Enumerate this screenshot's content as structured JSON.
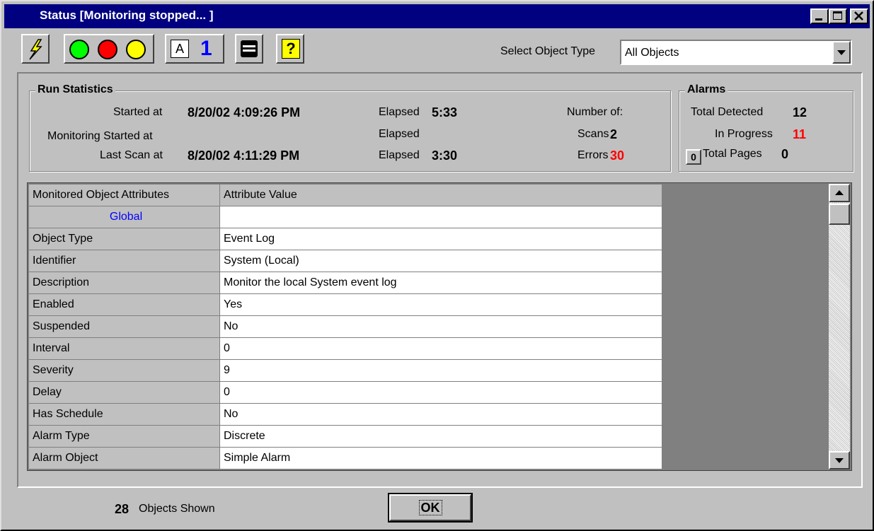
{
  "window": {
    "title": "Status [Monitoring stopped... ]"
  },
  "toolbar": {
    "select_label": "Select Object Type",
    "select_value": "All Objects",
    "number_button": "1"
  },
  "run_stats": {
    "group_label": "Run Statistics",
    "started_label": "Started at",
    "started_value": "8/20/02 4:09:26 PM",
    "monitoring_label": "Monitoring Started at",
    "lastscan_label": "Last Scan at",
    "lastscan_value": "8/20/02 4:11:29 PM",
    "elapsed_label": "Elapsed",
    "elapsed1": "5:33",
    "elapsed3": "3:30",
    "number_of": "Number of:",
    "scans_label": "Scans",
    "scans_value": "2",
    "errors_label": "Errors",
    "errors_value": "30"
  },
  "alarms": {
    "group_label": "Alarms",
    "total_detected_label": "Total Detected",
    "total_detected_value": "12",
    "in_progress_label": "In Progress",
    "in_progress_value": "11",
    "pages_button": "0",
    "total_pages_label": "Total Pages",
    "total_pages_value": "0"
  },
  "grid": {
    "headers": [
      "Monitored Object Attributes",
      "Attribute Value"
    ],
    "section": "Global",
    "rows": [
      [
        "Object Type",
        "Event Log"
      ],
      [
        "Identifier",
        "System (Local)"
      ],
      [
        "Description",
        "Monitor the local System event log"
      ],
      [
        "Enabled",
        "Yes"
      ],
      [
        "Suspended",
        "No"
      ],
      [
        "Interval",
        "0"
      ],
      [
        "Severity",
        "9"
      ],
      [
        "Delay",
        "0"
      ],
      [
        "Has Schedule",
        "No"
      ],
      [
        "Alarm Type",
        "Discrete"
      ],
      [
        "Alarm Object",
        "Simple Alarm"
      ]
    ]
  },
  "footer": {
    "count": "28",
    "count_label": "Objects Shown",
    "ok_label": "OK"
  },
  "colors": {
    "title_bar": "#000080",
    "error_red": "#ff0000",
    "link_blue": "#0000ff"
  }
}
